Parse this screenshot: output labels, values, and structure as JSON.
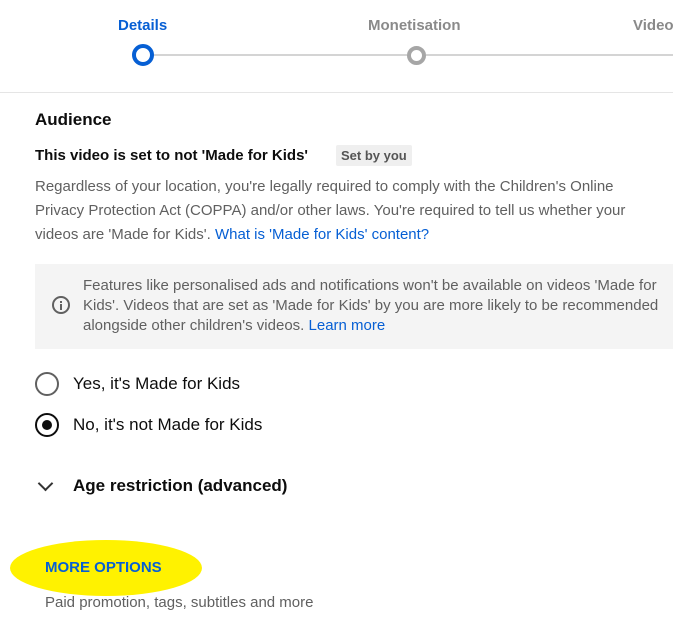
{
  "stepper": {
    "steps": [
      "Details",
      "Monetisation",
      "Video"
    ],
    "active": "Details"
  },
  "audience": {
    "heading": "Audience",
    "subtitle": "This video is set to not 'Made for Kids'",
    "badge": "Set by you",
    "description": "Regardless of your location, you're legally required to comply with the Children's Online Privacy Protection Act (COPPA) and/or other laws. You're required to tell us whether your videos are 'Made for Kids'.",
    "link": "What is 'Made for Kids' content?"
  },
  "info": {
    "text": "Features like personalised ads and notifications won't be available on videos 'Made for Kids'. Videos that are set as 'Made for Kids' by you are more likely to be recommended alongside other children's videos.",
    "link": "Learn more"
  },
  "radios": [
    {
      "label": "Yes, it's Made for Kids",
      "selected": false
    },
    {
      "label": "No, it's not Made for Kids",
      "selected": true
    }
  ],
  "age_restriction": {
    "label": "Age restriction (advanced)"
  },
  "more_options": {
    "label": "MORE OPTIONS",
    "description": "Paid promotion, tags, subtitles and more"
  },
  "colors": {
    "accent": "#065fd4",
    "highlight": "#fff200"
  }
}
